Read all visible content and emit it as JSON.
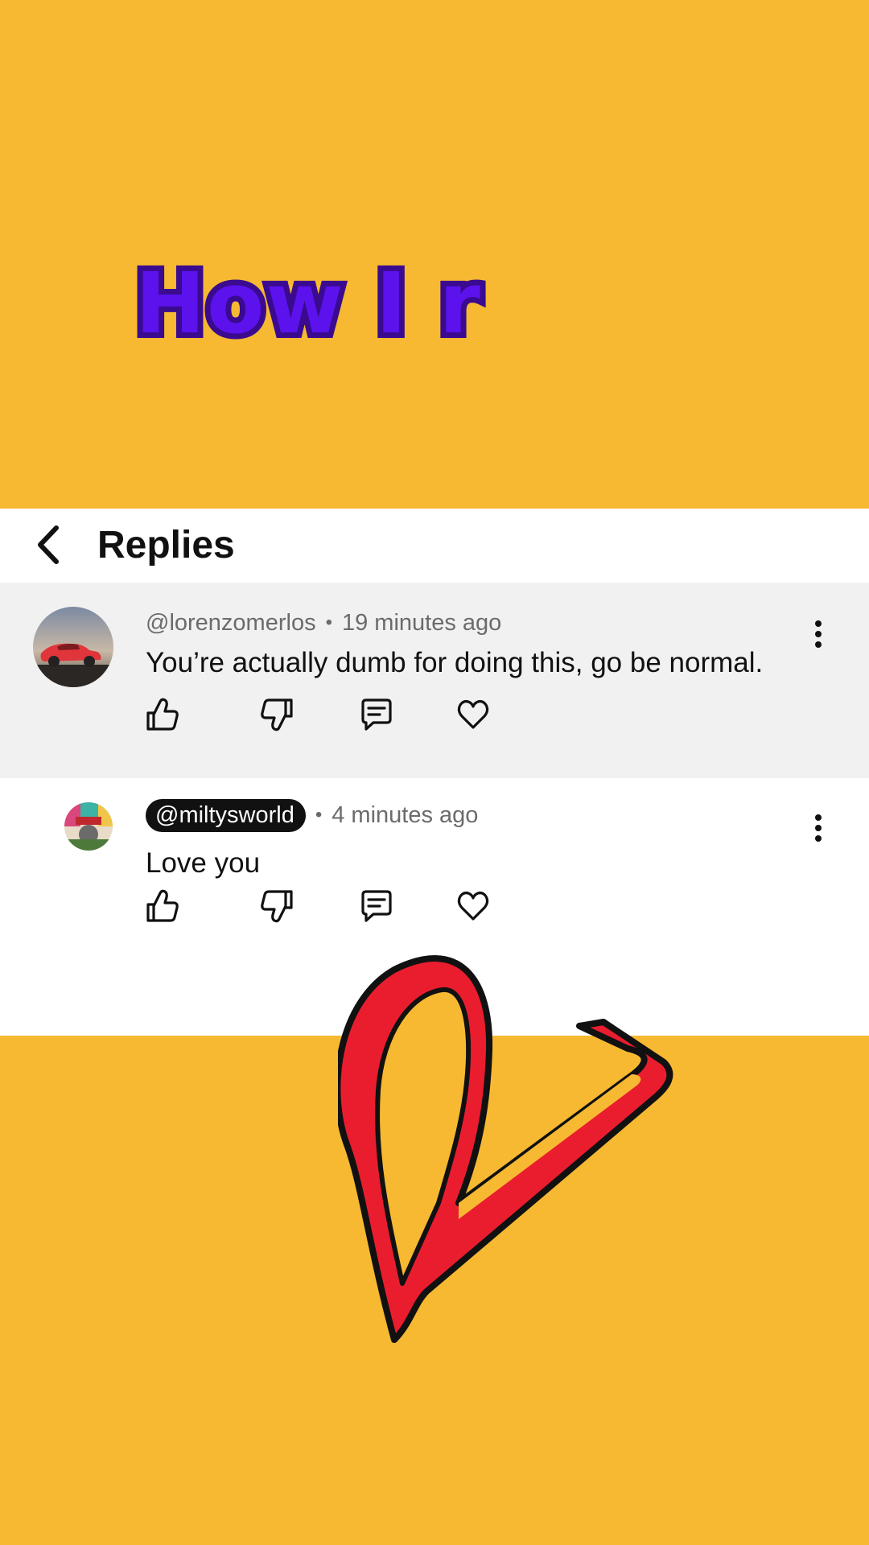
{
  "overlay": {
    "caption": "How I r"
  },
  "header": {
    "title": "Replies"
  },
  "parent_comment": {
    "handle": "@lorenzomerlos",
    "time": "19 minutes ago",
    "text": "You’re actually dumb for doing this, go be normal."
  },
  "reply_comment": {
    "handle": "@miltysworld",
    "time": "4 minutes ago",
    "text": "Love you"
  },
  "action_icons": [
    "thumbs-up-icon",
    "thumbs-down-icon",
    "reply-icon",
    "heart-icon"
  ],
  "colors": {
    "background": "#f7b931",
    "caption_fill": "#5b12ec",
    "heart": "#ea1d2f",
    "parent_bg": "#f1f1f1"
  }
}
